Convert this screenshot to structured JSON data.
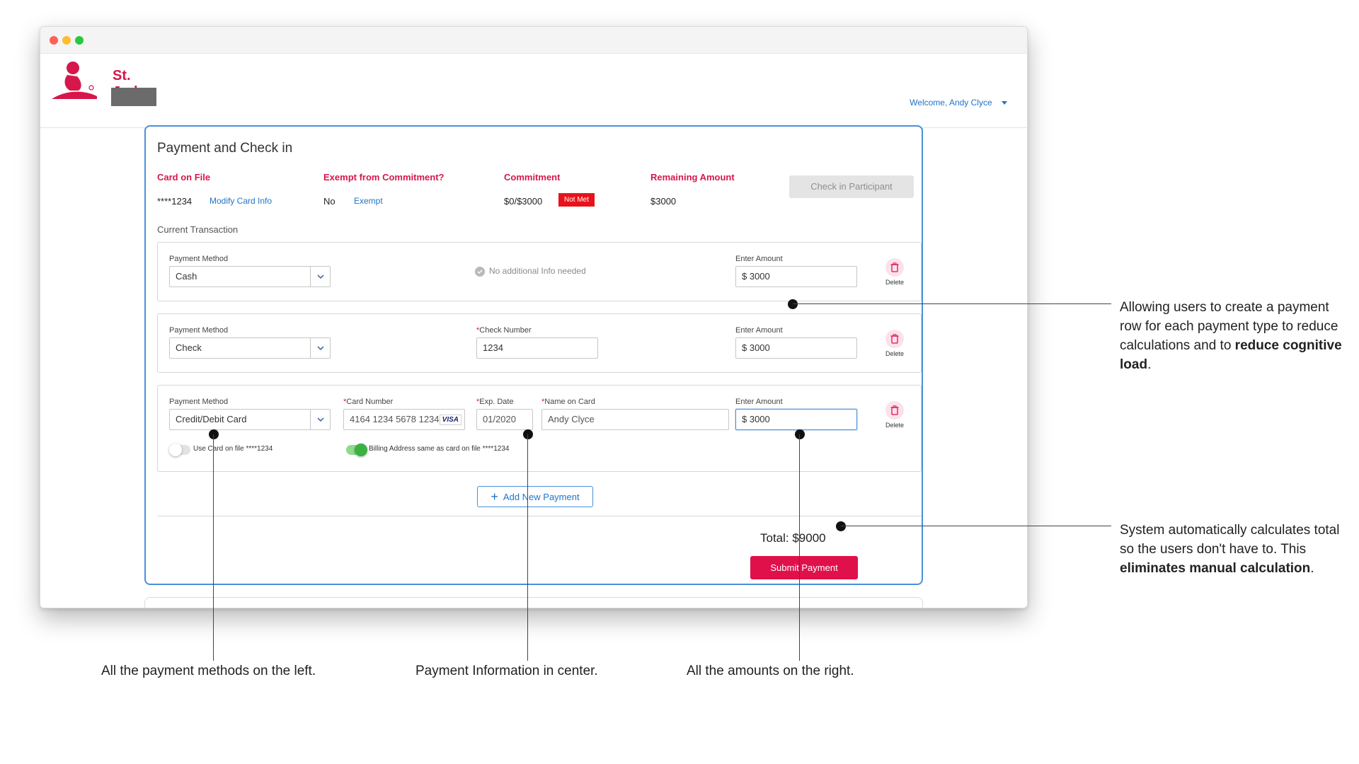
{
  "header": {
    "logo_text": "St. Jude",
    "welcome": "Welcome, Andy Clyce"
  },
  "panel": {
    "title": "Payment and Check in",
    "card_on_file_label": "Card on File",
    "card_on_file_value": "****1234",
    "modify_card_link": "Modify Card Info",
    "exempt_label": "Exempt from Commitment?",
    "exempt_value": "No",
    "exempt_link": "Exempt",
    "commitment_label": "Commitment",
    "commitment_value": "$0/$3000",
    "commitment_badge": "Not Met",
    "remaining_label": "Remaining Amount",
    "remaining_value": "$3000",
    "checkin_button": "Check in Participant",
    "section_label": "Current Transaction"
  },
  "rows": [
    {
      "method_label": "Payment Method",
      "method_value": "Cash",
      "info_text": "No additional Info needed",
      "amount_label": "Enter Amount",
      "amount_value": "$ 3000",
      "delete_label": "Delete"
    },
    {
      "method_label": "Payment Method",
      "method_value": "Check",
      "check_label": "Check Number",
      "check_value": "1234",
      "amount_label": "Enter Amount",
      "amount_value": "$ 3000",
      "delete_label": "Delete"
    },
    {
      "method_label": "Payment Method",
      "method_value": "Credit/Debit Card",
      "card_number_label": "Card Number",
      "card_number_value": "4164 1234 5678 1234",
      "card_brand": "VISA",
      "exp_label": "Exp. Date",
      "exp_value": "01/2020",
      "name_label": "Name on Card",
      "name_value": "Andy Clyce",
      "amount_label": "Enter Amount",
      "amount_value": "$ 3000",
      "delete_label": "Delete",
      "use_card_toggle": "Use Card on file ****1234",
      "use_card_on": false,
      "billing_toggle": "Billing Address same as card on file ****1234",
      "billing_on": true
    }
  ],
  "actions": {
    "add_payment": "Add New Payment",
    "total": "Total: $9000",
    "submit": "Submit Payment"
  },
  "annotations": {
    "right_1_pre": "Allowing users to create a payment row for each payment type to reduce calculations and to ",
    "right_1_bold": "reduce cognitive load",
    "right_1_post": ".",
    "right_2_pre": "System automatically calculates total so the users don't have to. This ",
    "right_2_bold": "eliminates manual calculation",
    "right_2_post": ".",
    "bottom_left": "All the payment methods on the left.",
    "bottom_center": "Payment Information in center.",
    "bottom_right": "All the amounts on the right."
  },
  "colors": {
    "brand": "#d6174a",
    "link": "#1f73c9",
    "panel_border": "#4a90d9",
    "submit": "#e0104b",
    "not_met": "#e8121a"
  }
}
